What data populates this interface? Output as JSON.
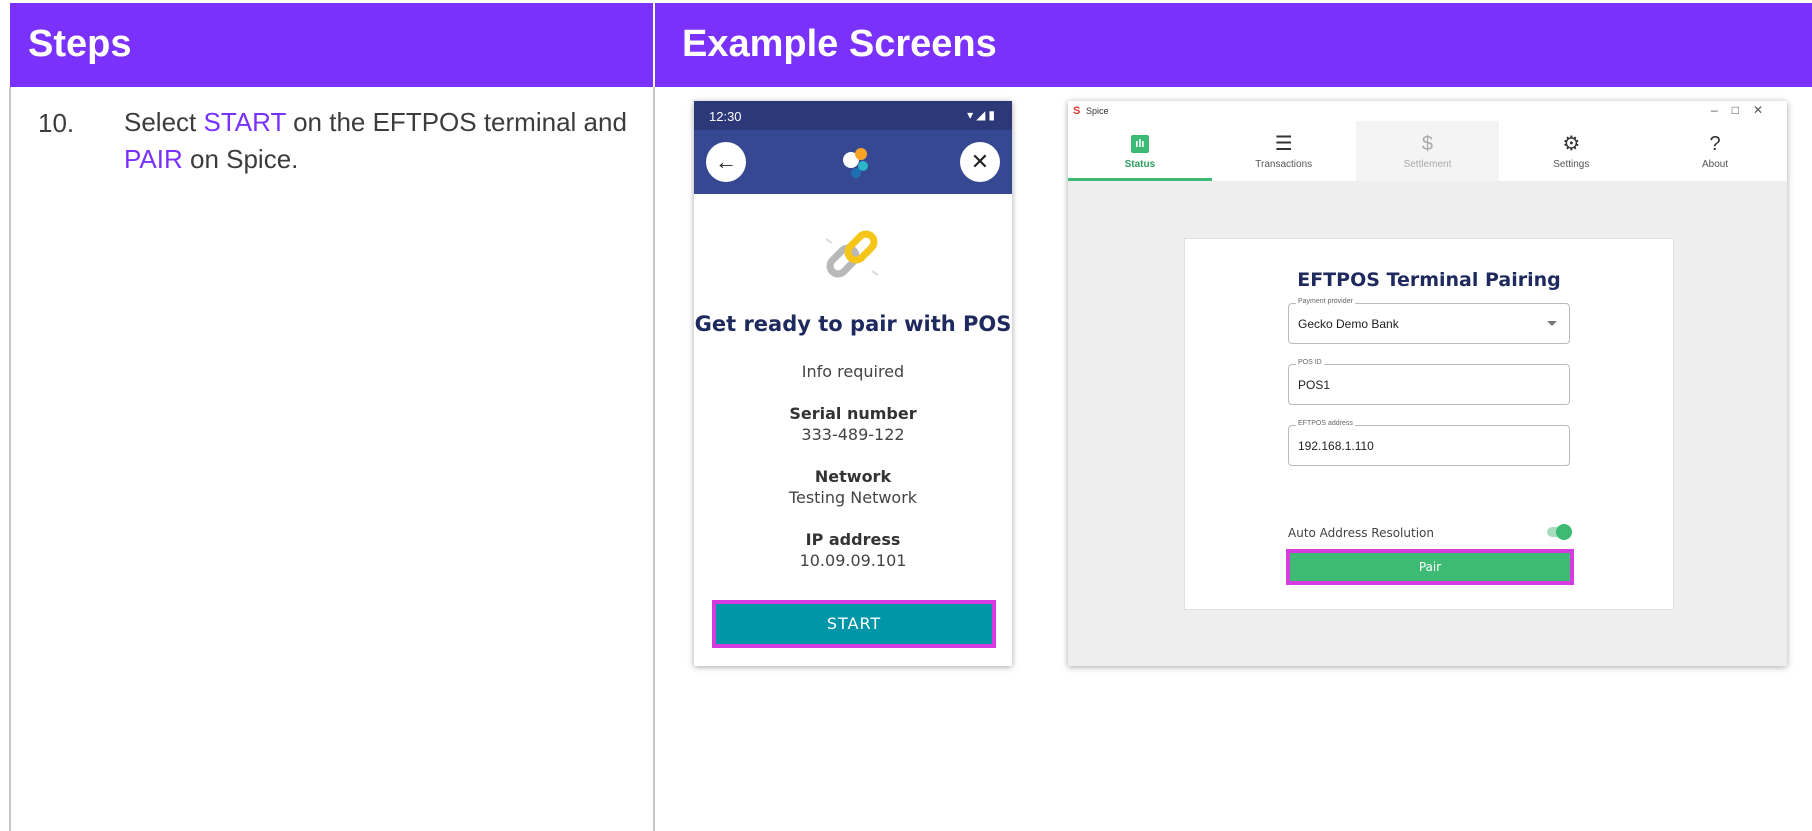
{
  "table": {
    "headers": {
      "steps": "Steps",
      "screens": "Example Screens"
    },
    "step": {
      "number": "10.",
      "text_1": "Select ",
      "highlight_1": "START",
      "text_2": " on the EFTPOS terminal and ",
      "highlight_2": "PAIR",
      "text_3": " on Spice."
    },
    "highlight_color": "#7a31fc",
    "header_color": "#7a31fc"
  },
  "phone": {
    "time": "12:30",
    "status_icons": "▾◢▮",
    "title": "Get ready to pair with POS",
    "info_required": "Info required",
    "serial_label": "Serial number",
    "serial_value": "333-489-122",
    "network_label": "Network",
    "network_value": "Testing Network",
    "ip_label": "IP address",
    "ip_value": "10.09.09.101",
    "start_label": "START",
    "back_icon": "←",
    "close_icon": "✕"
  },
  "desktop": {
    "app_name": "Spice",
    "window_controls": "–□✕",
    "tabs": [
      {
        "label": "Status",
        "icon": "bar-chart-icon",
        "glyph": "ılı"
      },
      {
        "label": "Transactions",
        "icon": "list-check-icon",
        "glyph": "☰"
      },
      {
        "label": "Settlement",
        "icon": "hand-dollar-icon",
        "glyph": "$"
      },
      {
        "label": "Settings",
        "icon": "gear-icon",
        "glyph": "⚙"
      },
      {
        "label": "About",
        "icon": "question-icon",
        "glyph": "?"
      }
    ],
    "card_title": "EFTPOS Terminal Pairing",
    "payment_provider_label": "Payment provider",
    "payment_provider_value": "Gecko Demo Bank",
    "pos_id_label": "POS ID",
    "pos_id_value": "POS1",
    "eftpos_address_label": "EFTPOS address",
    "eftpos_address_value": "192.168.1.110",
    "auto_resolution_label": "Auto Address Resolution",
    "auto_resolution_on": true,
    "pair_label": "Pair",
    "accent_color": "#3dbb74"
  }
}
